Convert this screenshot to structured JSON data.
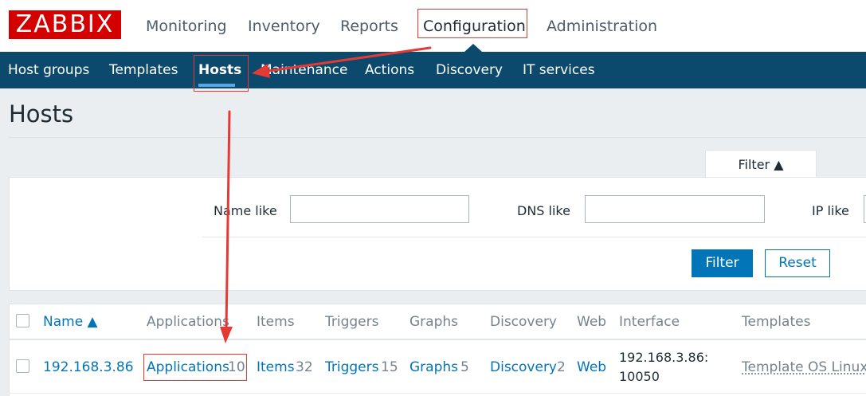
{
  "header": {
    "logo_text": "ZABBIX",
    "main_nav": [
      "Monitoring",
      "Inventory",
      "Reports",
      "Configuration",
      "Administration"
    ],
    "main_nav_selected": "Configuration"
  },
  "sub_nav": {
    "items": [
      "Host groups",
      "Templates",
      "Hosts",
      "Maintenance",
      "Actions",
      "Discovery",
      "IT services"
    ],
    "selected": "Hosts"
  },
  "page": {
    "title": "Hosts"
  },
  "filter": {
    "tab_label": "Filter ▲",
    "fields": [
      {
        "label": "Name like",
        "value": ""
      },
      {
        "label": "DNS like",
        "value": ""
      },
      {
        "label": "IP like",
        "value": ""
      }
    ],
    "apply_label": "Filter",
    "reset_label": "Reset"
  },
  "table": {
    "columns": {
      "name": "Name ▲",
      "applications": "Applications",
      "items": "Items",
      "triggers": "Triggers",
      "graphs": "Graphs",
      "discovery": "Discovery",
      "web": "Web",
      "interface": "Interface",
      "templates": "Templates"
    },
    "rows": [
      {
        "name": "192.168.3.86",
        "applications": {
          "label": "Applications",
          "count": "10"
        },
        "items": {
          "label": "Items",
          "count": "32"
        },
        "triggers": {
          "label": "Triggers",
          "count": "15"
        },
        "graphs": {
          "label": "Graphs",
          "count": "5"
        },
        "discovery": {
          "label": "Discovery",
          "count": "2"
        },
        "web": "Web",
        "interface": [
          "192.168.3.86:",
          "10050"
        ],
        "templates": "Template OS Linux"
      }
    ]
  },
  "colors": {
    "brand_red": "#d40000",
    "nav_dark": "#0b4a6d",
    "link_blue": "#0275b8",
    "annotation_red": "#e53935"
  }
}
